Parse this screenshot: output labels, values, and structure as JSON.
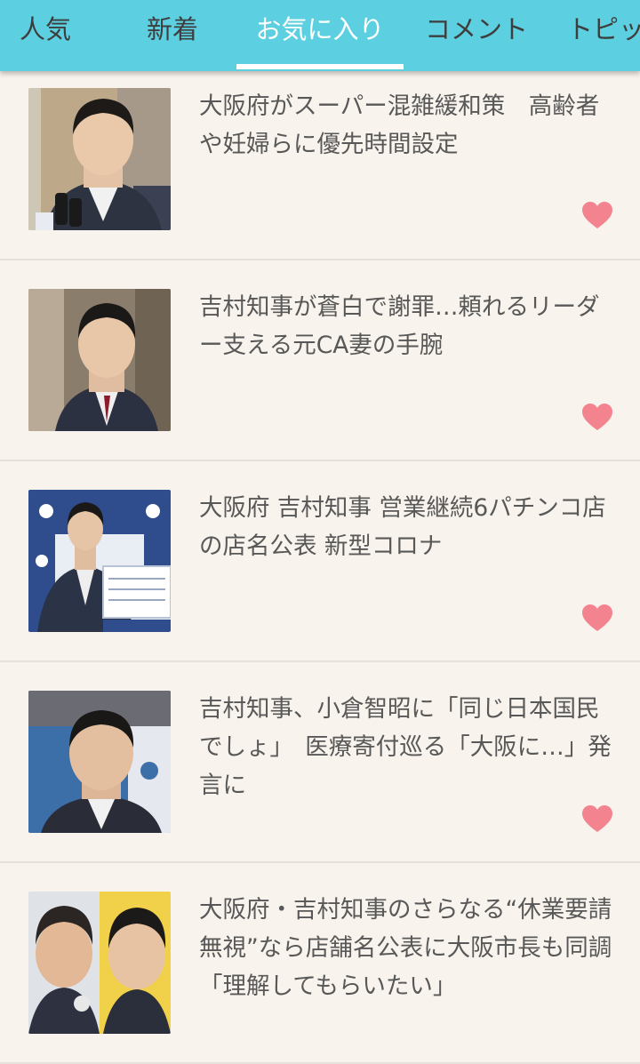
{
  "tabs": [
    {
      "label": "人気"
    },
    {
      "label": "新着"
    },
    {
      "label": "お気に入り"
    },
    {
      "label": "コメント"
    },
    {
      "label": "トピックス"
    }
  ],
  "active_tab": "お気に入り",
  "colors": {
    "header_bg": "#5ccfe0",
    "page_bg": "#f8f3ec",
    "heart": "#f2838f",
    "title_text": "#585858"
  },
  "articles": [
    {
      "title": "大阪府がスーパー混雑緩和策　高齢者や妊婦らに優先時間設定",
      "favorited": true,
      "thumbnail_icon": "news-photo-icon"
    },
    {
      "title": "吉村知事が蒼白で謝罪…頼れるリーダー支える元CA妻の手腕",
      "favorited": true,
      "thumbnail_icon": "news-photo-icon"
    },
    {
      "title": "大阪府 吉村知事 営業継続6パチンコ店の店名公表 新型コロナ",
      "favorited": true,
      "thumbnail_icon": "news-photo-icon"
    },
    {
      "title": "吉村知事、小倉智昭に「同じ日本国民でしょ」　医療寄付巡る「大阪に…」発言に",
      "favorited": true,
      "thumbnail_icon": "news-photo-icon"
    },
    {
      "title": "大阪府・吉村知事のさらなる“休業要請無視”なら店舗名公表に大阪市長も同調「理解してもらいたい」",
      "favorited": false,
      "thumbnail_icon": "news-photo-icon"
    }
  ]
}
